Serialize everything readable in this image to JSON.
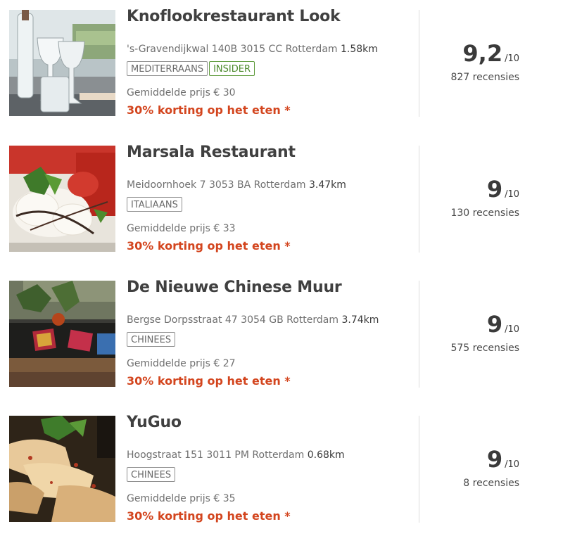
{
  "restaurants": [
    {
      "name": "Knoflookrestaurant Look",
      "address": "'s-Gravendijkwal 140B 3015 CC Rotterdam",
      "distance": "1.58km",
      "tags": [
        "MEDITERRAANS",
        "INSIDER"
      ],
      "price": "Gemiddelde prijs € 30",
      "promo": "30% korting op het eten *",
      "score": "9,2",
      "score_max": "/10",
      "reviews": "827 recensies",
      "image": "wine-glasses-table-photo"
    },
    {
      "name": "Marsala Restaurant",
      "address": "Meidoornhoek 7 3053 BA Rotterdam",
      "distance": "3.47km",
      "tags": [
        "ITALIAANS"
      ],
      "price": "Gemiddelde prijs € 33",
      "promo": "30% korting op het eten *",
      "score": "9",
      "score_max": "/10",
      "reviews": "130 recensies",
      "image": "caprese-salad-photo"
    },
    {
      "name": "De Nieuwe Chinese Muur",
      "address": "Bergse Dorpsstraat 47 3054 GB Rotterdam",
      "distance": "3.74km",
      "tags": [
        "CHINEES"
      ],
      "price": "Gemiddelde prijs € 27",
      "promo": "30% korting op het eten *",
      "score": "9",
      "score_max": "/10",
      "reviews": "575 recensies",
      "image": "chinese-interior-photo"
    },
    {
      "name": "YuGuo",
      "address": "Hoogstraat 151 3011 PM Rotterdam",
      "distance": "0.68km",
      "tags": [
        "CHINEES"
      ],
      "price": "Gemiddelde prijs € 35",
      "promo": "30% korting op het eten *",
      "score": "9",
      "score_max": "/10",
      "reviews": "8 recensies",
      "image": "fried-dish-photo"
    }
  ],
  "colors": {
    "promo": "#d3451e",
    "insider": "#4c8a2c",
    "divider": "#dcdcdc"
  }
}
